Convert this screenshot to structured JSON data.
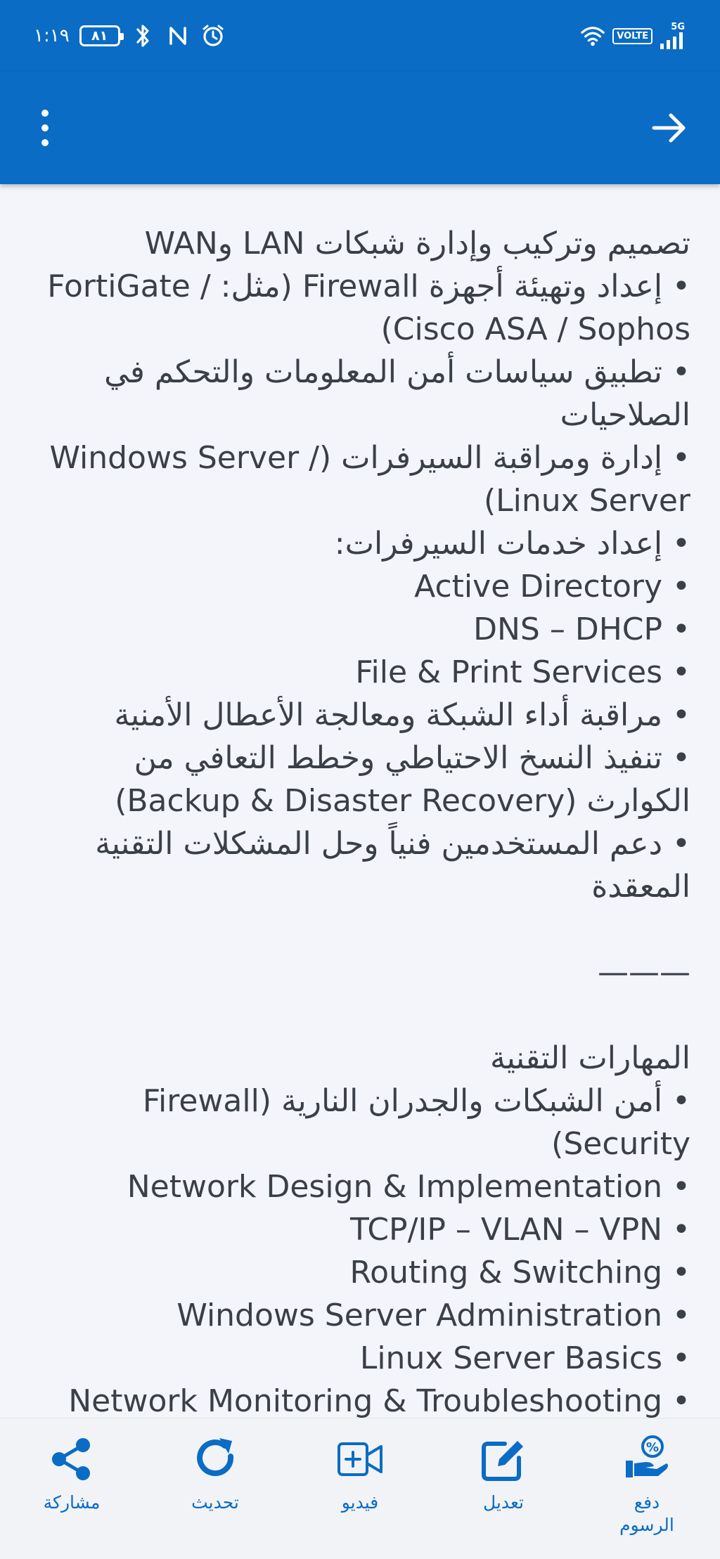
{
  "status_bar": {
    "time": "١:١٩",
    "battery_level": "٨١",
    "network_label": "5G",
    "volte_label": "VOLTE",
    "icons_left": [
      "battery-icon",
      "bluetooth-icon",
      "nfc-icon",
      "alarm-icon"
    ],
    "icons_right": [
      "wifi-icon",
      "volte-icon",
      "signal-icon"
    ]
  },
  "app_bar": {
    "background_color": "#0a6cc4",
    "menu_icon": "more-vertical-icon",
    "back_icon": "arrow-right-icon"
  },
  "content": {
    "text": "تصميم وتركيب وإدارة شبكات LAN وWAN\n• إعداد وتهيئة أجهزة Firewall (مثل: FortiGate / Cisco ASA / Sophos)\n• تطبيق سياسات أمن المعلومات والتحكم في الصلاحيات\n• إدارة ومراقبة السيرفرات (Windows Server / Linux Server)\n• إعداد خدمات السيرفرات:\n• Active Directory\n• DNS – DHCP\n• File & Print Services\n• مراقبة أداء الشبكة ومعالجة الأعطال الأمنية\n• تنفيذ النسخ الاحتياطي وخطط التعافي من الكوارث (Backup & Disaster Recovery)\n• دعم المستخدمين فنياً وحل المشكلات التقنية المعقدة\n\n———\n\nالمهارات التقنية\n• أمن الشبكات والجدران النارية (Firewall Security)\n• Network Design & Implementation\n• TCP/IP – VLAN – VPN\n• Routing & Switching\n• Windows Server Administration\n• Linux Server Basics\n• Network Monitoring & Troubleshooting"
  },
  "bottom_nav": {
    "accent_color": "#0a6cc4",
    "items": [
      {
        "label": "مشاركة",
        "icon": "share-icon"
      },
      {
        "label": "تحديث",
        "icon": "refresh-icon"
      },
      {
        "label": "فيديو",
        "icon": "video-add-icon"
      },
      {
        "label": "تعديل",
        "icon": "edit-icon"
      },
      {
        "label": "دفع\nالرسوم",
        "icon": "pay-fees-icon"
      }
    ]
  }
}
